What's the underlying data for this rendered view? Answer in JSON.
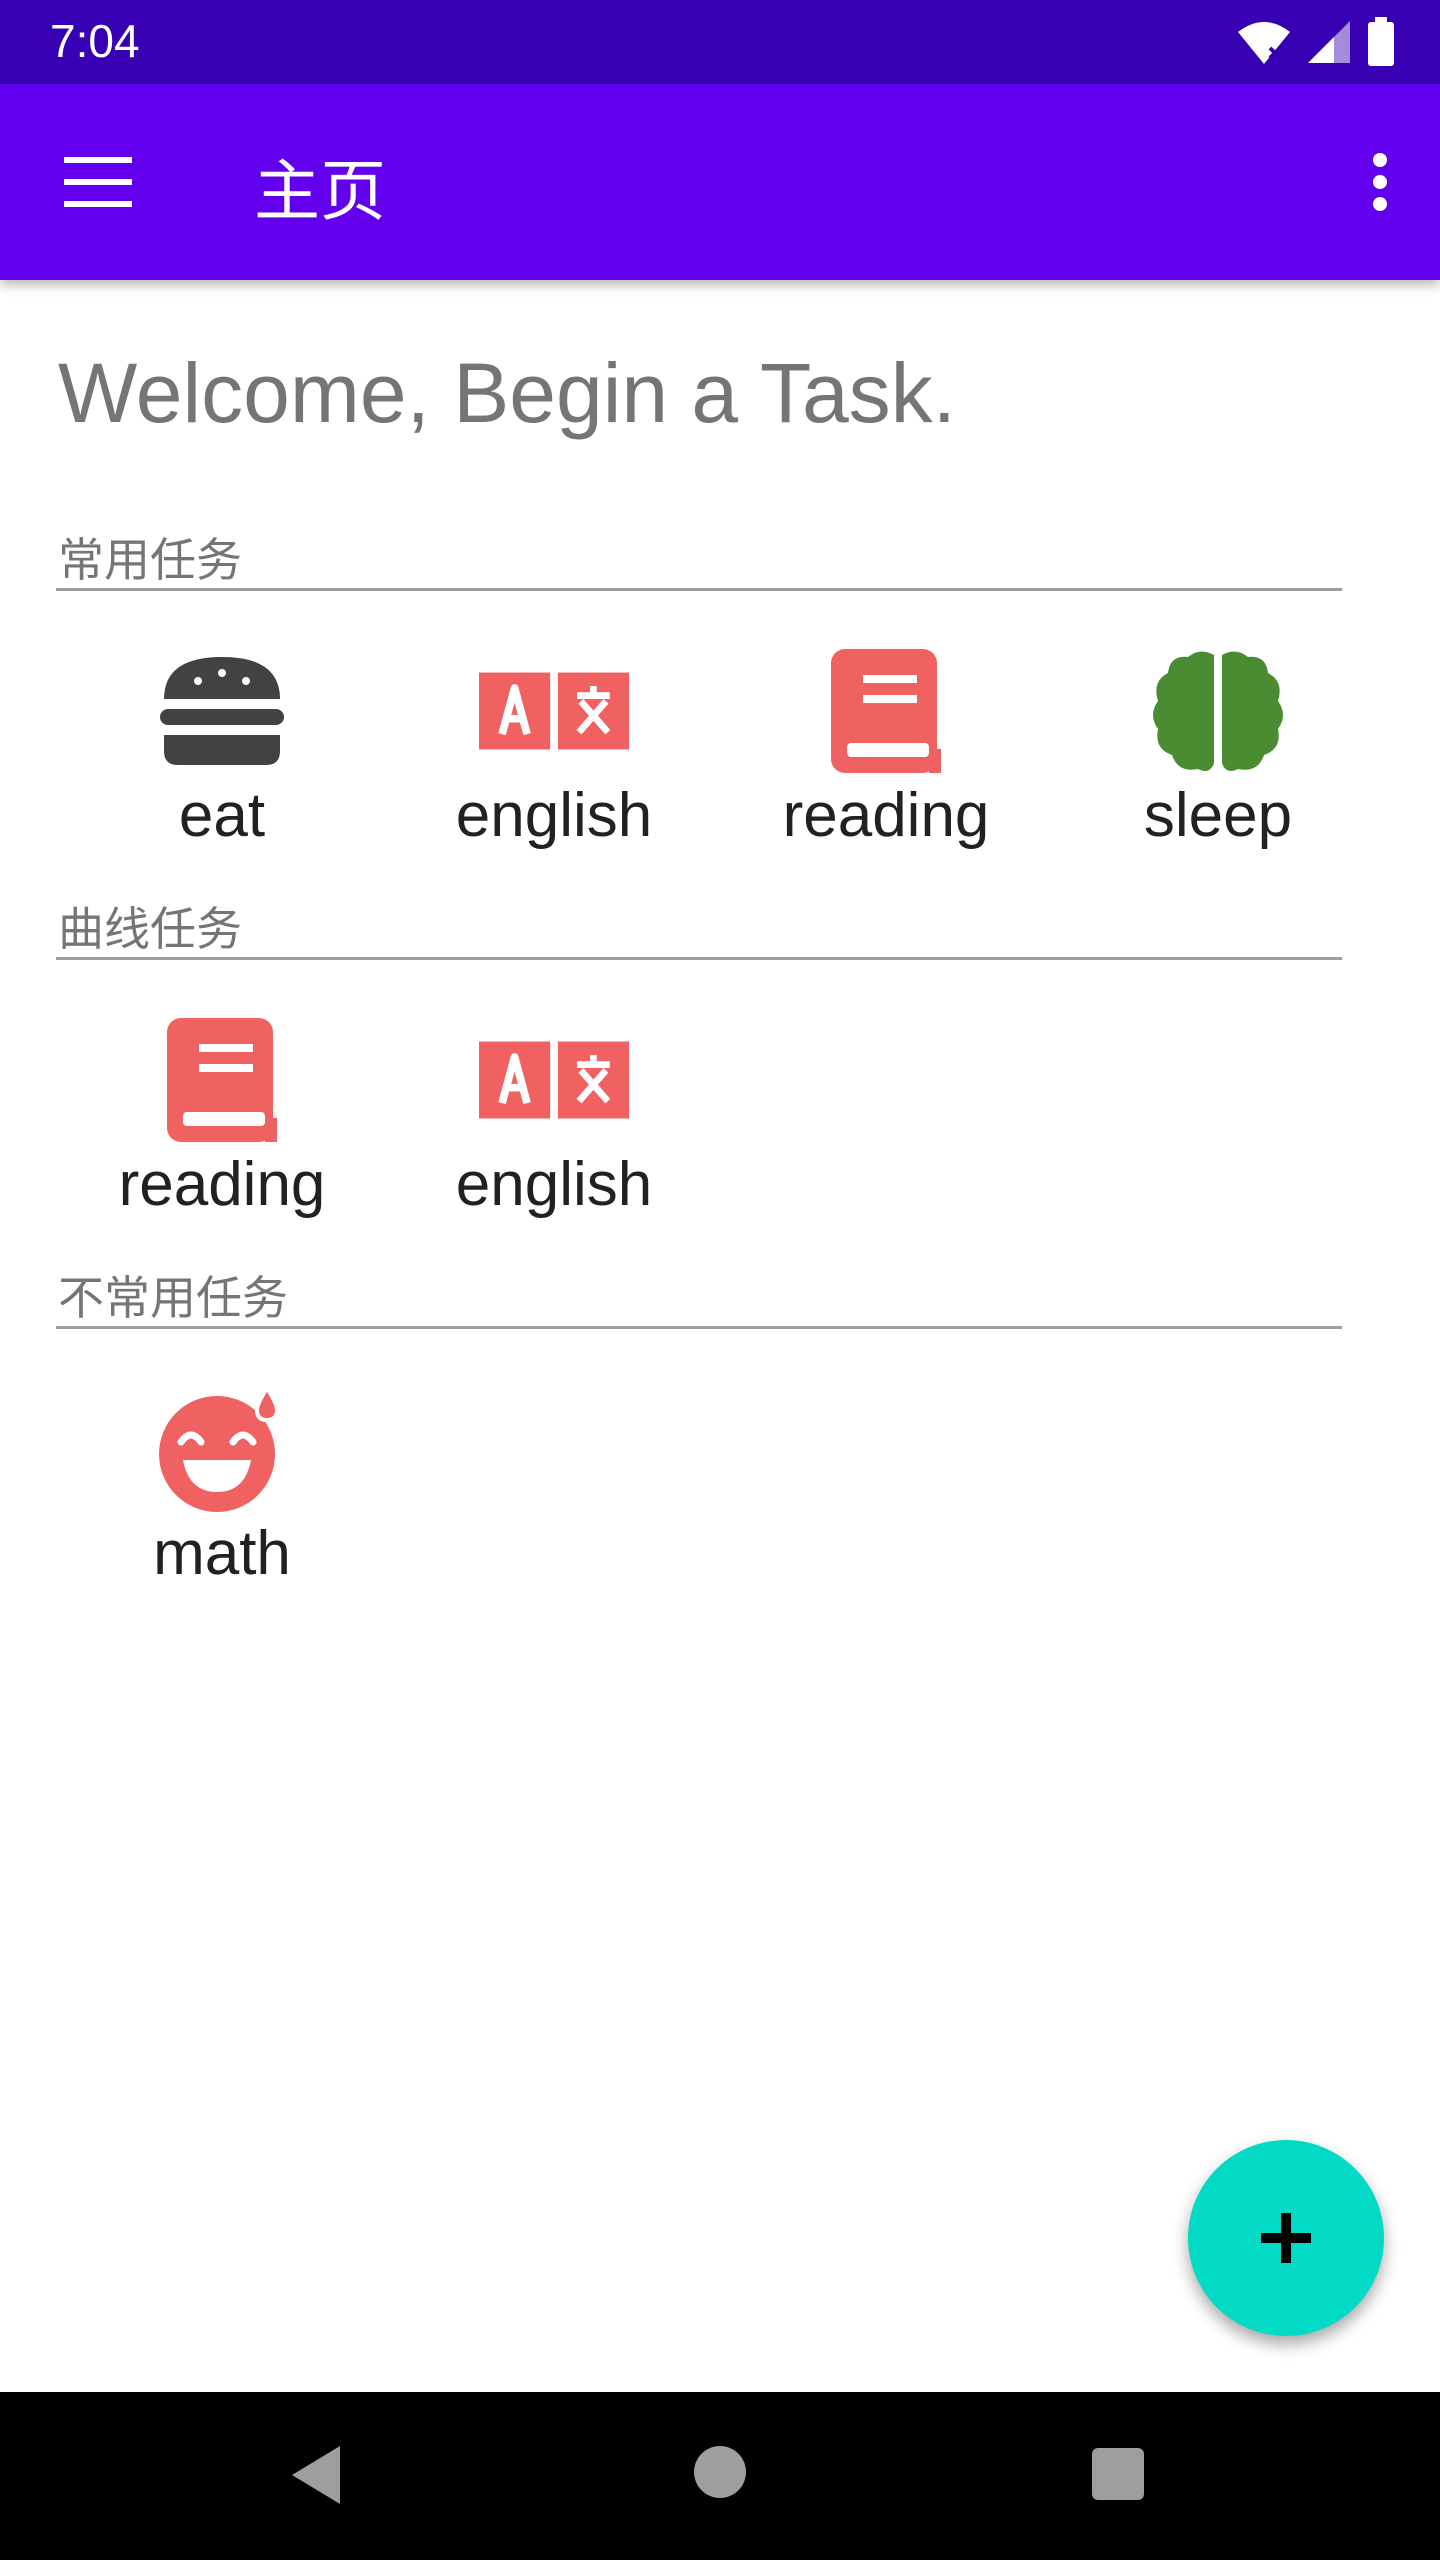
{
  "status_bar": {
    "time": "7:04"
  },
  "app_bar": {
    "title": "主页",
    "menu_icon": "hamburger-menu-icon",
    "more_icon": "more-vert-icon"
  },
  "welcome": "Welcome, Begin a Task.",
  "sections": [
    {
      "title": "常用任务",
      "tasks": [
        {
          "label": "eat",
          "icon": "hamburger-icon",
          "color": "#424242"
        },
        {
          "label": "english",
          "icon": "translate-icon",
          "color": "#f06161"
        },
        {
          "label": "reading",
          "icon": "book-icon",
          "color": "#f06161"
        },
        {
          "label": "sleep",
          "icon": "brain-icon",
          "color": "#4a8c32"
        }
      ]
    },
    {
      "title": "曲线任务",
      "tasks": [
        {
          "label": "reading",
          "icon": "book-icon",
          "color": "#f06161"
        },
        {
          "label": "english",
          "icon": "translate-icon",
          "color": "#f06161"
        }
      ]
    },
    {
      "title": "不常用任务",
      "tasks": [
        {
          "label": "math",
          "icon": "sweat-smile-icon",
          "color": "#f06161"
        }
      ]
    }
  ],
  "fab": {
    "icon": "plus-icon",
    "color": "#03dac5"
  },
  "colors": {
    "status_bar": "#3700b3",
    "app_bar": "#6200ee",
    "accent": "#03dac5"
  }
}
